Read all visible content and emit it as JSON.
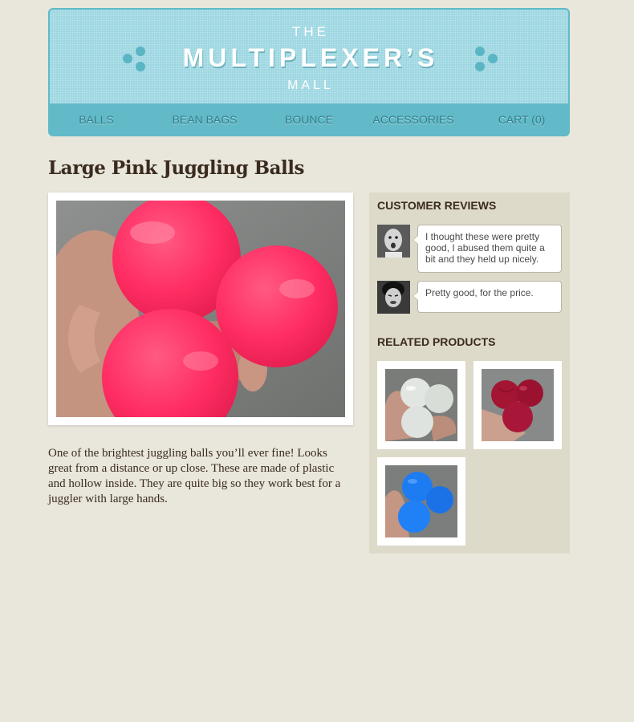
{
  "header": {
    "logo_the": "THE",
    "logo_main": "MULTIPLEXER’S",
    "logo_mall": "MALL",
    "nav": [
      "BALLS",
      "BEAN BAGS",
      "BOUNCE",
      "ACCESSORIES",
      "CART (0)"
    ]
  },
  "product": {
    "title": "Large Pink Juggling Balls",
    "description": "One of the brightest juggling balls you’ll ever fine! Looks great from a distance or up close. These are made of plastic and hollow inside. They are quite big so they work best for a juggler with large hands.",
    "ball_color": "#ff2d63"
  },
  "sidebar": {
    "reviews_heading": "CUSTOMER REVIEWS",
    "reviews": [
      {
        "text": "I thought these were pretty good, I abused them quite a bit and they held up nicely."
      },
      {
        "text": "Pretty good, for the price."
      }
    ],
    "related_heading": "RELATED PRODUCTS",
    "related": [
      {
        "icon": "white-balls-image",
        "color": "#e2e6e2"
      },
      {
        "icon": "red-balls-image",
        "color": "#a31532"
      },
      {
        "icon": "blue-balls-image",
        "color": "#1d7cf2"
      }
    ]
  },
  "colors": {
    "background": "#e9e6dc",
    "header_light": "#9fd8e2",
    "header_dark": "#62bac8",
    "sidebar": "#dedac9",
    "text": "#3a2b1e"
  }
}
